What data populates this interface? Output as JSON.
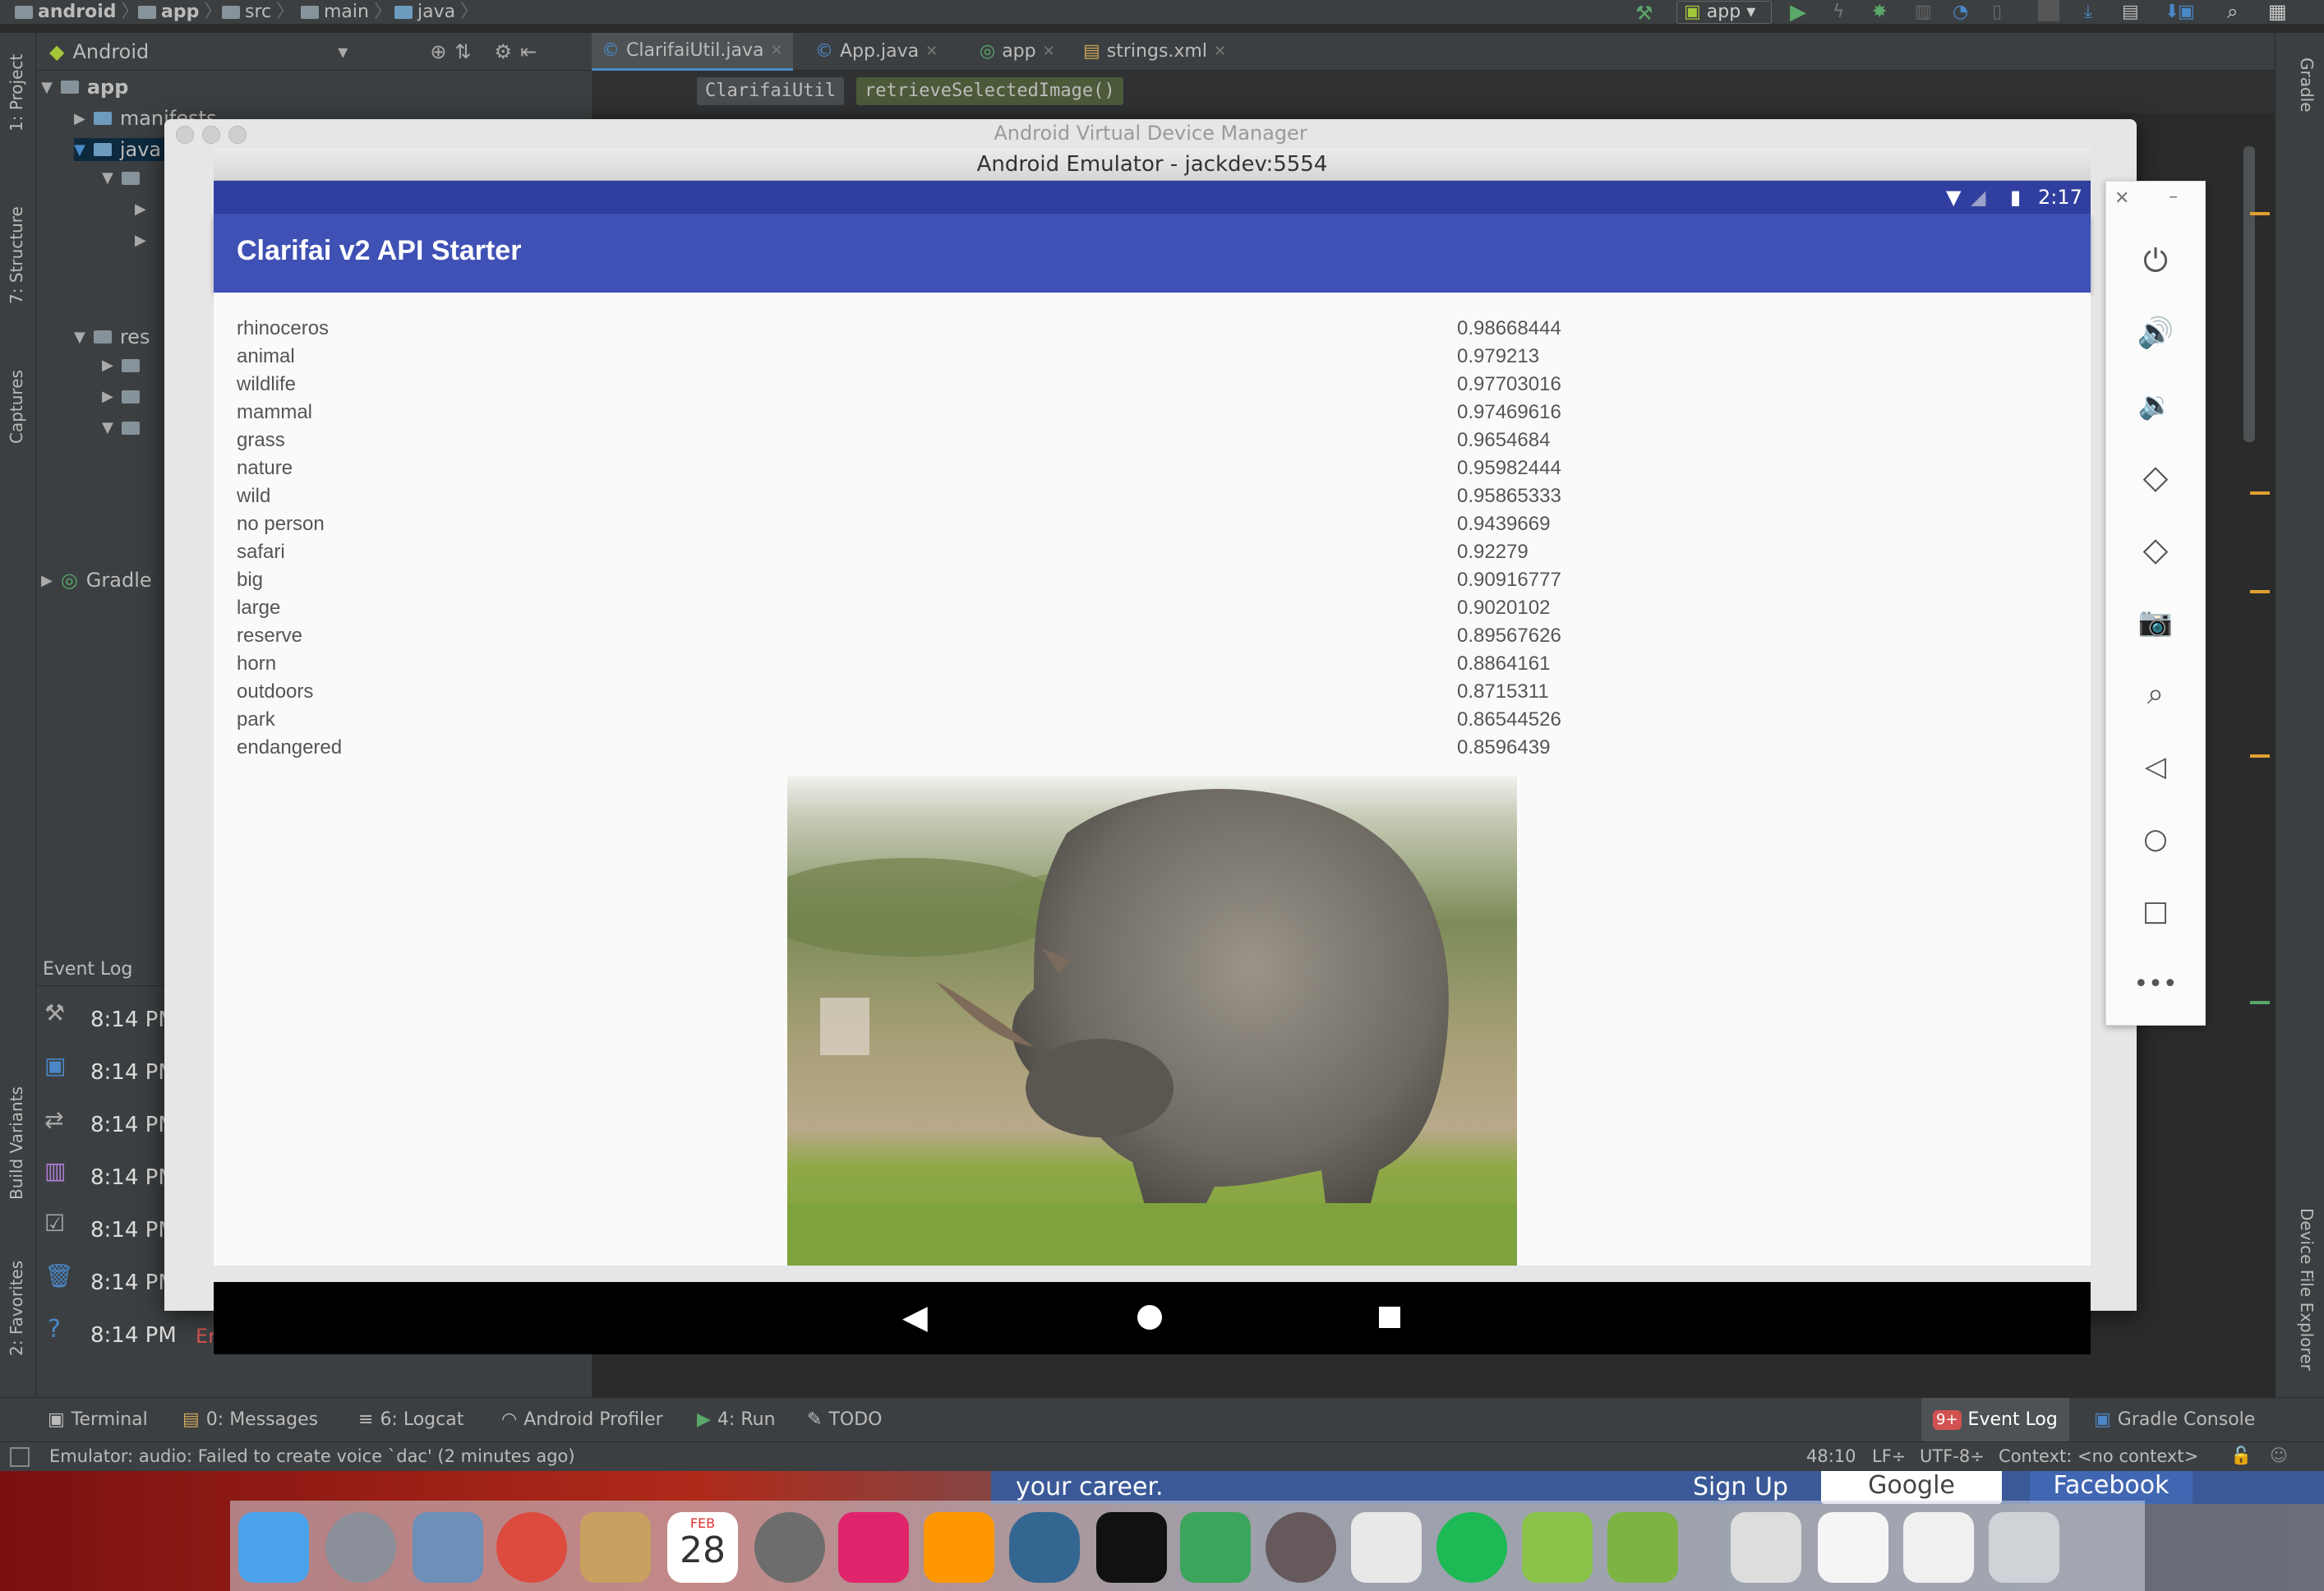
{
  "breadcrumbs": [
    "android",
    "app",
    "src",
    "main",
    "java"
  ],
  "toolbar": {
    "run_config": "app"
  },
  "project_panel": {
    "view_selector": "Android",
    "nodes": [
      "app",
      "manifests",
      "java",
      "res",
      "Gradle"
    ]
  },
  "editor_tabs": [
    {
      "label": "ClarifaiUtil.java",
      "active": true
    },
    {
      "label": "App.java",
      "active": false
    },
    {
      "label": "app",
      "active": false
    },
    {
      "label": "strings.xml",
      "active": false
    }
  ],
  "editor_breadcrumbs": [
    "ClarifaiUtil",
    "retrieveSelectedImage()"
  ],
  "left_strip": [
    "1: Project",
    "7: Structure",
    "Captures",
    "Build Variants",
    "2: Favorites"
  ],
  "right_strip": [
    "Gradle",
    "Device File Explorer"
  ],
  "event_log": {
    "title": "Event Log",
    "times": [
      "8:14 PM",
      "8:14 PM",
      "8:14 PM",
      "8:14 PM",
      "8:14 PM",
      "8:14 PM",
      "8:14 PM"
    ],
    "last_suffix": "Er"
  },
  "bottom_tools": [
    {
      "label": "Terminal"
    },
    {
      "label": "0: Messages"
    },
    {
      "label": "6: Logcat"
    },
    {
      "label": "Android Profiler"
    },
    {
      "label": "4: Run"
    },
    {
      "label": "TODO"
    },
    {
      "label": "Event Log",
      "badge": "9+"
    },
    {
      "label": "Gradle Console"
    }
  ],
  "status_bar": {
    "message": "Emulator: audio: Failed to create voice `dac' (2 minutes ago)",
    "position": "48:10",
    "line_sep": "LF÷",
    "encoding": "UTF-8÷",
    "context": "Context: <no context>"
  },
  "avd_manager_title": "Android Virtual Device Manager",
  "emulator": {
    "window_title": "Android Emulator - jackdev:5554",
    "time": "2:17",
    "app_title": "Clarifai v2 API Starter",
    "predictions": [
      {
        "label": "rhinoceros",
        "value": "0.98668444"
      },
      {
        "label": "animal",
        "value": "0.979213"
      },
      {
        "label": "wildlife",
        "value": "0.97703016"
      },
      {
        "label": "mammal",
        "value": "0.97469616"
      },
      {
        "label": "grass",
        "value": "0.9654684"
      },
      {
        "label": "nature",
        "value": "0.95982444"
      },
      {
        "label": "wild",
        "value": "0.95865333"
      },
      {
        "label": "no person",
        "value": "0.9439669"
      },
      {
        "label": "safari",
        "value": "0.92279"
      },
      {
        "label": "big",
        "value": "0.90916777"
      },
      {
        "label": "large",
        "value": "0.9020102"
      },
      {
        "label": "reserve",
        "value": "0.89567626"
      },
      {
        "label": "horn",
        "value": "0.8864161"
      },
      {
        "label": "outdoors",
        "value": "0.8715311"
      },
      {
        "label": "park",
        "value": "0.86544526"
      },
      {
        "label": "endangered",
        "value": "0.8596439"
      }
    ]
  },
  "emulator_controls": [
    "power-icon",
    "volume-up-icon",
    "volume-down-icon",
    "rotate-left-icon",
    "rotate-right-icon",
    "camera-icon",
    "zoom-icon",
    "back-icon",
    "home-icon",
    "overview-icon",
    "more-icon"
  ],
  "browser_snippet": {
    "text": "your career.",
    "signup": "Sign Up",
    "google": "Google",
    "facebook": "Facebook"
  },
  "calendar": {
    "month": "FEB",
    "day": "28"
  },
  "colors": {
    "app_bar": "#3f51b5",
    "status_bar": "#303f9f",
    "ide_bg": "#2b2b2b"
  }
}
